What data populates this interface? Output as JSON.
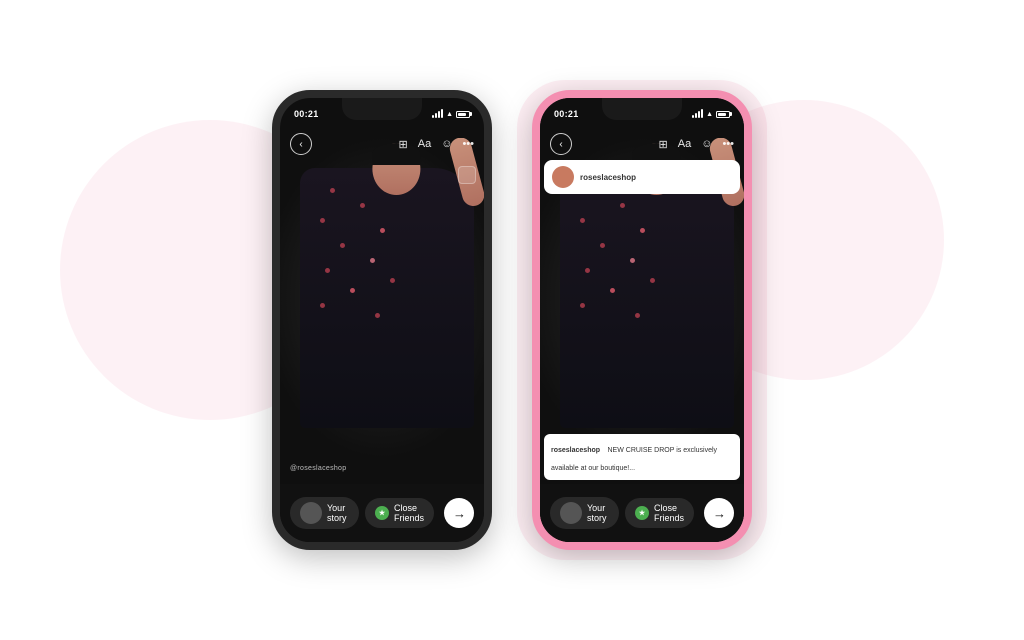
{
  "page": {
    "background": "#ffffff"
  },
  "phone1": {
    "status": {
      "time": "00:21"
    },
    "toolbar": {
      "back_label": "‹",
      "icons": [
        "⊞",
        "Aa",
        "☺",
        "···"
      ]
    },
    "watermark": "@roseslaceshop",
    "share_bar": {
      "your_story_label": "Your story",
      "close_friends_label": "Close Friends"
    }
  },
  "phone2": {
    "status": {
      "time": "00:21"
    },
    "post": {
      "username": "roseslaceshop"
    },
    "caption": {
      "username": "roseslaceshop",
      "text": "NEW CRUISE DROP is exclusively available at our boutique!..."
    },
    "share_bar": {
      "your_story_label": "Your story",
      "close_friends_label": "Close Friends"
    }
  }
}
